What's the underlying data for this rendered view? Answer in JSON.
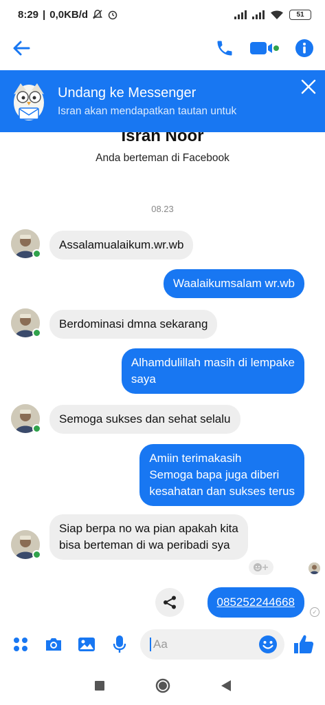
{
  "status_bar": {
    "time": "8:29",
    "network_speed": "0,0KB/d",
    "battery": "51"
  },
  "header": {
    "back_icon": "arrow-left-icon",
    "call_icon": "phone-icon",
    "video_icon": "video-camera-icon",
    "info_icon": "info-icon"
  },
  "invite_banner": {
    "title": "Undang ke Messenger",
    "subtitle": "Isran akan mendapatkan tautan untuk"
  },
  "profile": {
    "name": "Isran Noor",
    "subtitle": "Anda berteman di Facebook"
  },
  "conversation": {
    "timestamp": "08.23",
    "messages": [
      {
        "direction": "in",
        "text": "Assalamualaikum.wr.wb"
      },
      {
        "direction": "out",
        "text": "Waalaikumsalam wr.wb"
      },
      {
        "direction": "in",
        "text": "Berdominasi dmna sekarang"
      },
      {
        "direction": "out",
        "text": "Alhamdulillah masih di lempake\nsaya"
      },
      {
        "direction": "in",
        "text": "Semoga sukses dan sehat selalu"
      },
      {
        "direction": "out",
        "text": "Amiin terimakasih\nSemoga bapa juga diberi\nkesahatan dan sukses terus"
      },
      {
        "direction": "in",
        "text": "Siap berpa no wa pian apakah kita\nbisa berteman di wa peribadi sya"
      },
      {
        "direction": "out",
        "text": "085252244668"
      }
    ]
  },
  "composer": {
    "placeholder": "Aa"
  },
  "colors": {
    "accent": "#1877f2",
    "incoming_bubble": "#eeeeee",
    "online": "#31a24c"
  }
}
